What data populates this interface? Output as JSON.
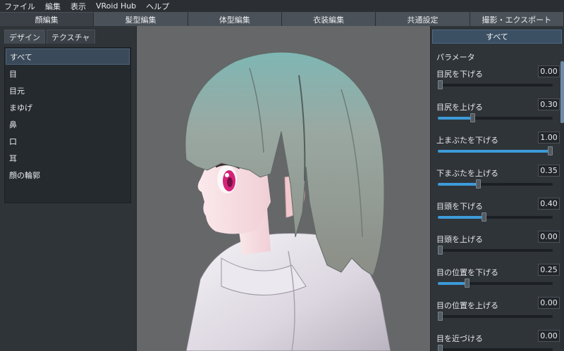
{
  "menu": [
    "ファイル",
    "編集",
    "表示",
    "VRoid Hub",
    "ヘルプ"
  ],
  "main_tabs": [
    "顔編集",
    "髪型編集",
    "体型編集",
    "衣装編集",
    "共通設定",
    "撮影・エクスポート"
  ],
  "active_main_tab": 0,
  "sub_tabs": [
    "デザイン",
    "テクスチャ"
  ],
  "active_sub_tab": 0,
  "categories": [
    "すべて",
    "目",
    "目元",
    "まゆげ",
    "鼻",
    "口",
    "耳",
    "顔の輪郭"
  ],
  "selected_category": 0,
  "right_panel": {
    "header": "すべて",
    "section_title": "パラメータ",
    "params": [
      {
        "label": "目尻を下げる",
        "value": "0.00",
        "level": 0.0
      },
      {
        "label": "目尻を上げる",
        "value": "0.30",
        "level": 0.3
      },
      {
        "label": "上まぶたを下げる",
        "value": "1.00",
        "level": 1.0
      },
      {
        "label": "下まぶたを上げる",
        "value": "0.35",
        "level": 0.35
      },
      {
        "label": "目頭を下げる",
        "value": "0.40",
        "level": 0.4
      },
      {
        "label": "目頭を上げる",
        "value": "0.00",
        "level": 0.0
      },
      {
        "label": "目の位置を下げる",
        "value": "0.25",
        "level": 0.25
      },
      {
        "label": "目の位置を上げる",
        "value": "0.00",
        "level": 0.0
      },
      {
        "label": "目を近づける",
        "value": "0.00",
        "level": 0.0
      }
    ]
  },
  "colors": {
    "accent": "#3d9bd9",
    "header_selected": "#3c5064",
    "panel_bg": "#2f3439",
    "viewport_bg": "#666768"
  }
}
